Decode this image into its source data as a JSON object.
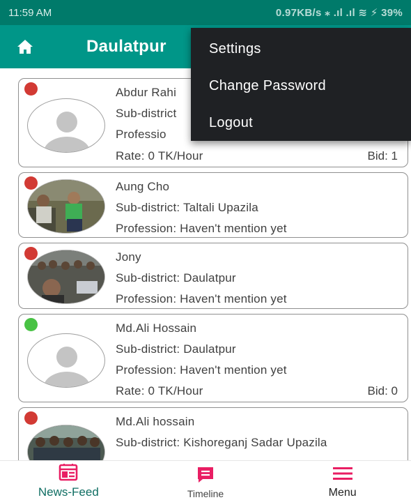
{
  "status_bar": {
    "time": "11:59 AM",
    "right": "0.97KB/s ⁎ .ıl .ıl ≋ ⚡ 39%"
  },
  "app_bar": {
    "title": "Daulatpur",
    "home_icon": "home-icon"
  },
  "menu": {
    "items": [
      {
        "label": "Settings"
      },
      {
        "label": "Change Password"
      },
      {
        "label": "Logout"
      }
    ]
  },
  "cards": [
    {
      "status_color": "red",
      "avatar": "default",
      "name": "Abdur Rahi",
      "subdistrict": "Sub-district",
      "profession": "Professio",
      "rate": "Rate: 0 TK/Hour",
      "bid": "Bid: 1"
    },
    {
      "status_color": "red",
      "avatar": "photo",
      "name": "Aung Cho",
      "subdistrict": "Sub-district: Taltali Upazila",
      "profession": "Profession: Haven't mention yet"
    },
    {
      "status_color": "red",
      "avatar": "photo",
      "name": "Jony",
      "subdistrict": "Sub-district: Daulatpur",
      "profession": "Profession: Haven't mention yet"
    },
    {
      "status_color": "green",
      "avatar": "default",
      "name": "Md.Ali Hossain",
      "subdistrict": "Sub-district: Daulatpur",
      "profession": "Profession: Haven't mention yet",
      "rate": "Rate: 0 TK/Hour",
      "bid": "Bid: 0"
    },
    {
      "status_color": "red",
      "avatar": "photo",
      "name": "Md.Ali hossain",
      "subdistrict": "Sub-district: Kishoreganj Sadar Upazila"
    }
  ],
  "bottom_nav": [
    {
      "label": "News-Feed",
      "icon": "newsfeed-icon",
      "active": true
    },
    {
      "label": "Timeline",
      "icon": "timeline-icon"
    },
    {
      "label": "Menu",
      "icon": "menu-icon"
    }
  ],
  "colors": {
    "primary": "#009688",
    "status_bar": "#007a6a",
    "accent_pink": "#e91e63",
    "status_red": "#d23a34",
    "status_green": "#48c244",
    "menu_bg": "#1f2124"
  }
}
